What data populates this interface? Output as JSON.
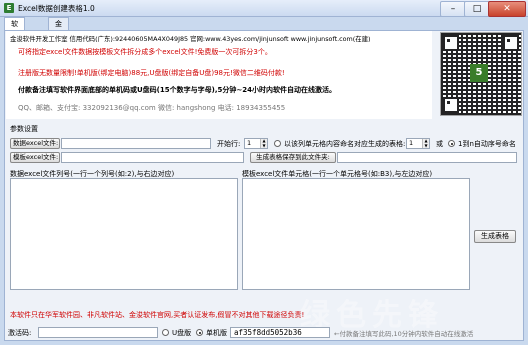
{
  "window": {
    "title": "Excel数据创建表格1.0",
    "app_icon": "E"
  },
  "tabs": [
    {
      "label": "软件设置"
    },
    {
      "label": "金浚软件"
    }
  ],
  "info": {
    "company_line": "金浚软件开发工作室  信用代码(广东):92440605MA4X049J85  官网:www.43yes.com/jinjunsoft  www.jinjunsoft.com(在建)",
    "line1": "可将指定excel文件数据按模板文件拆分成多个excel文件!免费版一次可拆分3个。",
    "line2": "注册版无数量限制!单机版(绑定电脑)88元,U盘版(绑定自备U盘)98元!微信二维码付款!",
    "line3": "付款备注填写软件界面底部的单机码或U盘码(15个数字与字母),5分钟~24小时内软件自动在线激活。",
    "contact": "QQ、邮箱、支付宝: 332092136@qq.com    微信: hangshong    电话: 18934355455"
  },
  "params": {
    "section_label": "参数设置",
    "data_file_button": "数据excel文件:",
    "data_file_value": "",
    "template_file_button": "模板excel文件:",
    "template_file_value": "",
    "start_row_label": "开始行:",
    "start_row_value": "1",
    "name_by_cell_label": "以该列单元格内容命名对应生成的表格:",
    "name_col_value": "1",
    "or_label": "或",
    "auto_number_label": "1到n自动序号命名",
    "output_folder_button": "生成表格保存到此文件夹:",
    "output_folder_value": ""
  },
  "columns": {
    "data_label": "数据excel文件列号(一行一个列号(如:2),与右边对应)",
    "template_label": "模板excel文件单元格(一行一个单元格号(如:B3),与左边对应)",
    "generate_button": "生成表格"
  },
  "footer": {
    "notice": "本软件只在华军软件园、非凡软件站、金浚软件官网,买者认证发布,假冒不对其他下载途径负责!",
    "activation_label": "激活码:",
    "activation_value": "",
    "usb_label": "U盘版",
    "single_label": "单机版",
    "machine_code": "af35f8dd5052b36",
    "hint": "←付款备注填写此码,10分钟内软件自动在线激活"
  },
  "watermark": "绿色先锋"
}
